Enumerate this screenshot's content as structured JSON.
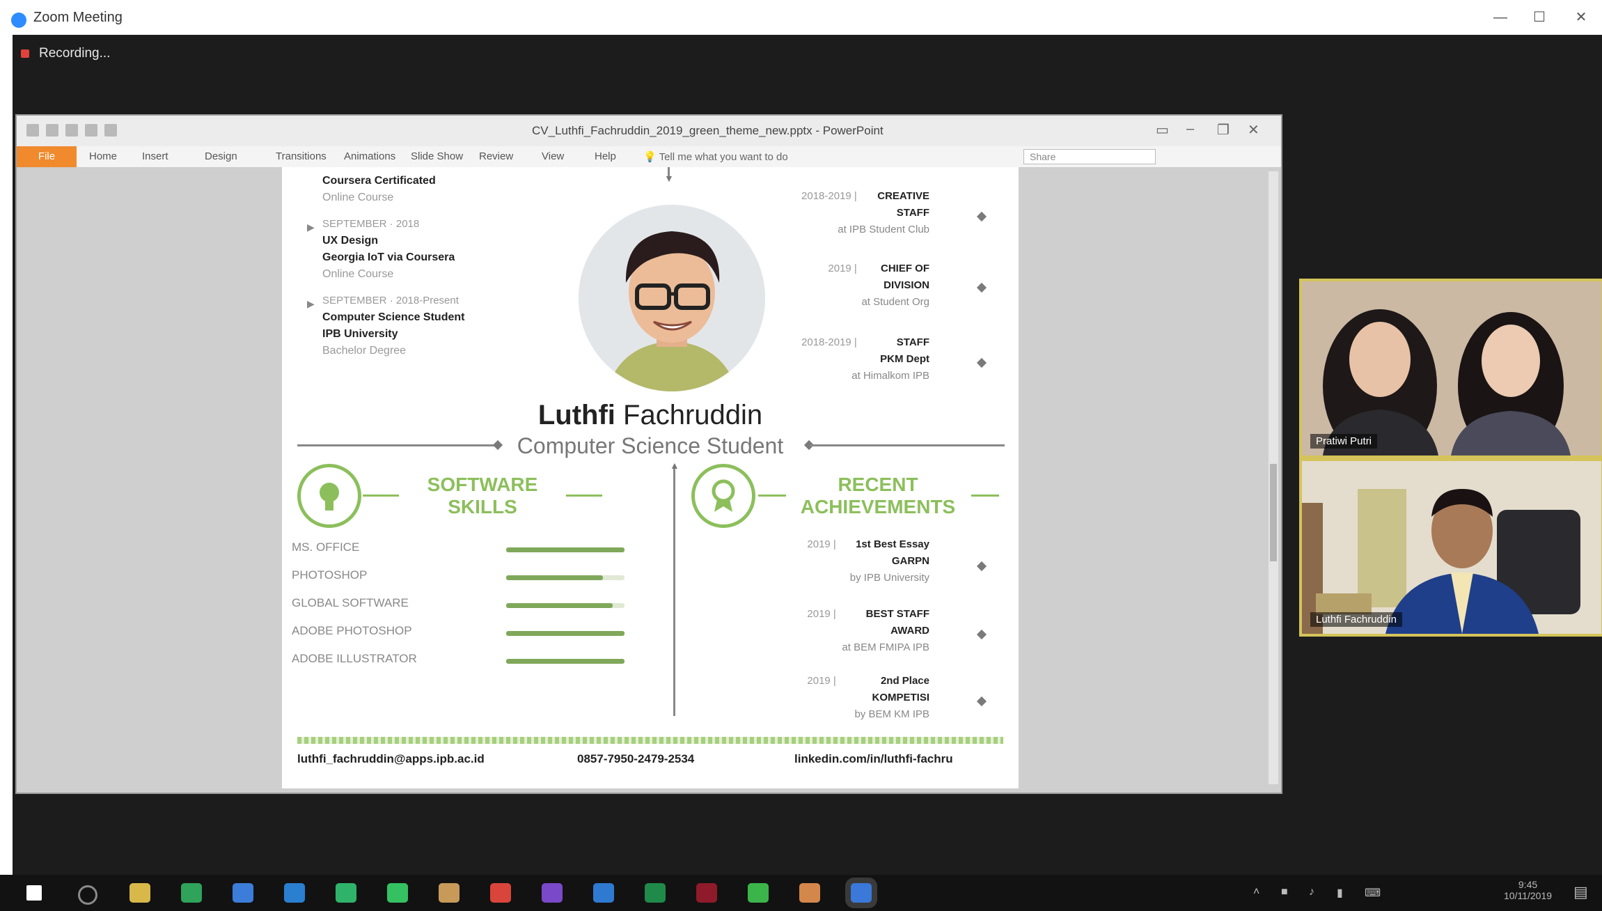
{
  "zoom": {
    "window_title": "Zoom Meeting",
    "recording_label": "Recording...",
    "window_controls": [
      "—",
      "☐",
      "✕"
    ]
  },
  "powerpoint": {
    "doc_title": "CV_Luthfi_Fachruddin_2019_green_theme_new.pptx - PowerPoint",
    "ribbon_tabs": [
      "File",
      "Home",
      "Insert",
      "Design",
      "Transitions",
      "Animations",
      "Slide Show",
      "Review",
      "View",
      "Help"
    ],
    "tell_me": "Tell me what you want to do",
    "share_box": "Share"
  },
  "slide": {
    "timeline_left": [
      {
        "date": "",
        "title": "Coursera Certificated",
        "sub": "Online Course",
        "partial": true
      },
      {
        "date": "SEPTEMBER · 2018",
        "title": "UX Design\nGeorgia IoT via Coursera",
        "sub": "Online Course"
      },
      {
        "date": "SEPTEMBER · 2018-Present",
        "title": "Computer Science Student\nIPB University",
        "sub": "Bachelor Degree"
      }
    ],
    "timeline_right_top": [
      {
        "date": "2018-2019 |",
        "title": "CREATIVE\nSTAFF",
        "sub": "at IPB Student Club"
      },
      {
        "date": "2019 |",
        "title": "CHIEF OF\nDIVISION",
        "sub": "at Student Org"
      },
      {
        "date": "2018-2019 |",
        "title": "STAFF\nPKM Dept",
        "sub": "at Himalkom IPB"
      }
    ],
    "name_bold": "Luthfi",
    "name_light": " Fachruddin",
    "role": "Computer Science Student",
    "skills_title": "SOFTWARE\nSKILLS",
    "achievements_title": "RECENT\nACHIEVEMENTS",
    "skills": [
      {
        "name": "MS. OFFICE",
        "level": 1.0
      },
      {
        "name": "PHOTOSHOP",
        "level": 0.82
      },
      {
        "name": "GLOBAL SOFTWARE",
        "level": 0.9
      },
      {
        "name": "ADOBE PHOTOSHOP",
        "level": 1.0
      },
      {
        "name": "ADOBE ILLUSTRATOR",
        "level": 1.0
      }
    ],
    "achievements": [
      {
        "date": "2019 |",
        "title": "1st Best Essay\nGARPN",
        "sub": "by IPB University"
      },
      {
        "date": "2019 |",
        "title": "BEST STAFF\nAWARD",
        "sub": "at BEM FMIPA IPB"
      },
      {
        "date": "2019 |",
        "title": "2nd Place\nKOMPETISI",
        "sub": "by BEM KM IPB"
      }
    ],
    "footer_email": "luthfi_fachruddin@apps.ipb.ac.id",
    "footer_phone": "0857-7950-2479-2534",
    "footer_linkedin": "linkedin.com/in/luthfi-fachru"
  },
  "participants": [
    {
      "name": "Pratiwi Putri"
    },
    {
      "name": "Luthfi Fachruddin"
    }
  ],
  "taskbar": {
    "tray_time": "9:45",
    "tray_date": "10/11/2019",
    "icon_colors": [
      "#ffffff",
      "#8a8a8a",
      "#d9b84a",
      "#2fa35a",
      "#3c7dd9",
      "#2b7fd1",
      "#2fb36a",
      "#35c162",
      "#c79a5a",
      "#d9453a",
      "#7a49c9",
      "#2f7ad1",
      "#1f8a4a",
      "#8e1a2a",
      "#3bb54a",
      "#d4874a",
      "#3a78d9"
    ]
  }
}
